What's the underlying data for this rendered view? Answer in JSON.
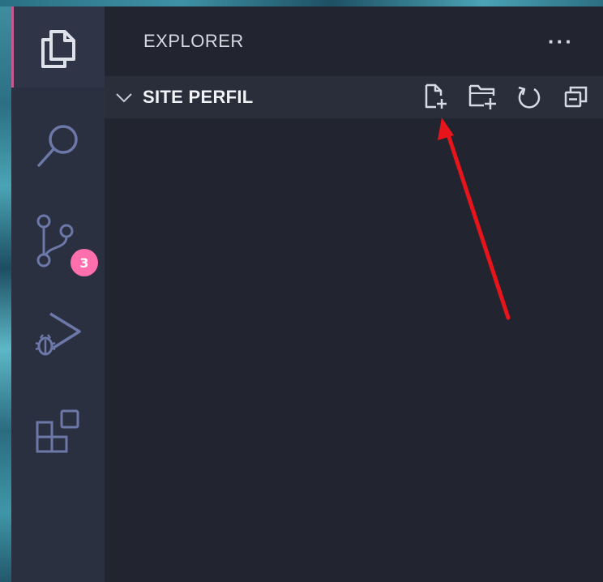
{
  "explorer": {
    "title": "EXPLORER",
    "more_actions_label": "···"
  },
  "section": {
    "title": "SITE PERFIL"
  },
  "activity_bar": {
    "items": [
      {
        "icon": "files-icon",
        "active": true
      },
      {
        "icon": "search-icon",
        "active": false
      },
      {
        "icon": "source-control-icon",
        "active": false,
        "badge": "3"
      },
      {
        "icon": "run-debug-icon",
        "active": false
      },
      {
        "icon": "extensions-icon",
        "active": false
      }
    ]
  },
  "header_actions": [
    {
      "icon": "new-file-icon"
    },
    {
      "icon": "new-folder-icon"
    },
    {
      "icon": "refresh-icon"
    },
    {
      "icon": "collapse-all-icon"
    }
  ],
  "colors": {
    "activity_bar_bg": "#2b3040",
    "sidebar_bg": "#222530",
    "section_header_bg": "#2a2e3b",
    "icon_color": "#6b78a8",
    "badge_color": "#ff6fae",
    "active_indicator": "#c05a8f",
    "annotation_arrow": "#e8141b"
  }
}
